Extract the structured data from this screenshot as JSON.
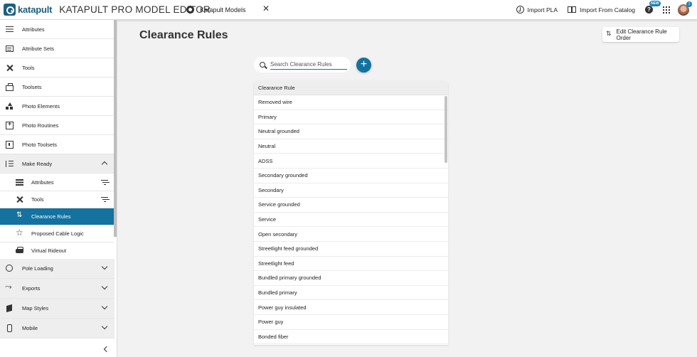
{
  "header": {
    "logo_text": "katapult",
    "app_title": "KATAPULT PRO MODEL EDITOR",
    "tab_label": "Katapult Models",
    "tab_close": "✕",
    "import_pla": "Import PLA",
    "import_catalog": "Import From Catalog",
    "help": "?",
    "new_badge": "NEW",
    "notification_count": "1"
  },
  "sidebar": {
    "items": [
      {
        "label": "Attributes",
        "icon": "list-icon"
      },
      {
        "label": "Attribute Sets",
        "icon": "table-icon"
      },
      {
        "label": "Tools",
        "icon": "tools-icon"
      },
      {
        "label": "Toolsets",
        "icon": "toolbox-icon"
      },
      {
        "label": "Photo Elements",
        "icon": "shapes-icon"
      },
      {
        "label": "Photo Routines",
        "icon": "add-box-icon"
      },
      {
        "label": "Photo Toolsets",
        "icon": "photo-toolset-icon"
      }
    ],
    "make_ready": {
      "label": "Make Ready",
      "children": [
        {
          "label": "Attributes"
        },
        {
          "label": "Tools"
        },
        {
          "label": "Clearance Rules"
        },
        {
          "label": "Proposed Cable Logic"
        },
        {
          "label": "Virtual Rideout"
        }
      ]
    },
    "groups": [
      {
        "label": "Pole Loading"
      },
      {
        "label": "Exports"
      },
      {
        "label": "Map Styles"
      },
      {
        "label": "Mobile"
      }
    ]
  },
  "main": {
    "title": "Clearance Rules",
    "edit_order_label": "Edit Clearance Rule Order",
    "search_placeholder": "Search Clearance Rules",
    "add_label": "+",
    "table": {
      "header": "Clearance Rule",
      "rows": [
        "Removed wire",
        "Primary",
        "Neutral grounded",
        "Neutral",
        "ADSS",
        "Secondary grounded",
        "Secondary",
        "Service grounded",
        "Service",
        "Open secondary",
        "Streetlight feed grounded",
        "Streetlight feed",
        "Bundled primary grounded",
        "Bundled primary",
        "Power guy insulated",
        "Power guy",
        "Bonded fiber"
      ]
    }
  },
  "colors": {
    "accent": "#13729f",
    "brand": "#1d5f80",
    "background": "#f2f2f2"
  }
}
